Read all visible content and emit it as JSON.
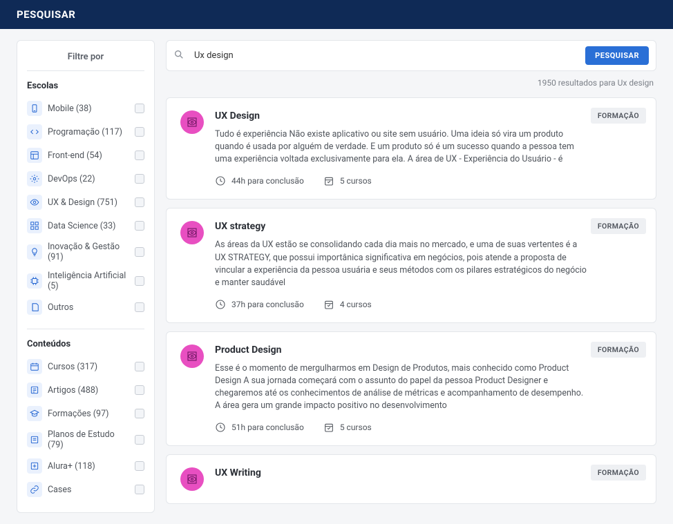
{
  "topbar": {
    "title": "PESQUISAR"
  },
  "sidebar": {
    "title": "Filtre por",
    "sections": [
      {
        "heading": "Escolas",
        "items": [
          {
            "icon": "mobile",
            "label": "Mobile (38)"
          },
          {
            "icon": "code",
            "label": "Programação (117)"
          },
          {
            "icon": "layout",
            "label": "Front-end (54)"
          },
          {
            "icon": "gear",
            "label": "DevOps (22)"
          },
          {
            "icon": "eye",
            "label": "UX & Design (751)"
          },
          {
            "icon": "grid",
            "label": "Data Science (33)"
          },
          {
            "icon": "bulb",
            "label": "Inovação & Gestão (91)"
          },
          {
            "icon": "chip",
            "label": "Inteligência Artificial (5)"
          },
          {
            "icon": "note",
            "label": "Outros"
          }
        ]
      },
      {
        "heading": "Conteúdos",
        "items": [
          {
            "icon": "calendar",
            "label": "Cursos (317)"
          },
          {
            "icon": "article",
            "label": "Artigos (488)"
          },
          {
            "icon": "cap",
            "label": "Formações (97)"
          },
          {
            "icon": "list",
            "label": "Planos de Estudo (79)"
          },
          {
            "icon": "plus",
            "label": "Alura+ (118)"
          },
          {
            "icon": "link",
            "label": "Cases"
          }
        ]
      }
    ]
  },
  "search": {
    "value": "Ux design",
    "placeholder": "",
    "button": "PESQUISAR",
    "results_meta": "1950 resultados para Ux design"
  },
  "results": [
    {
      "badge": "FORMAÇÃO",
      "title": "UX Design",
      "desc": "Tudo é experiência Não existe aplicativo ou site sem usuário. Uma ideia só vira um produto quando é usada por alguém de verdade. E um produto só é um sucesso quando a pessoa tem uma experiência voltada exclusivamente para ela. A área de UX - Experiência do Usuário - é",
      "duration": "44h para conclusão",
      "courses": "5 cursos"
    },
    {
      "badge": "FORMAÇÃO",
      "title": "UX strategy",
      "desc": "As áreas da UX estão se consolidando cada dia mais no mercado, e uma de suas vertentes é a UX STRATEGY, que possui importânica significativa em negócios, pois atende a proposta de vincular a experiência da pessoa usuária e seus métodos com os pilares estratégicos do negócio e manter saudável",
      "duration": "37h para conclusão",
      "courses": "4 cursos"
    },
    {
      "badge": "FORMAÇÃO",
      "title": "Product Design",
      "desc": "Esse é o momento de mergulharmos em Design de Produtos, mais conhecido como Product Design A sua jornada começará com o assunto do papel da pessoa Product Designer e chegaremos até os conhecimentos de análise de métricas e acompanhamento de desempenho. A área gera um grande impacto positivo no desenvolvimento",
      "duration": "51h para conclusão",
      "courses": "5 cursos"
    },
    {
      "badge": "FORMAÇÃO",
      "title": "UX Writing",
      "desc": "",
      "duration": "",
      "courses": ""
    }
  ]
}
